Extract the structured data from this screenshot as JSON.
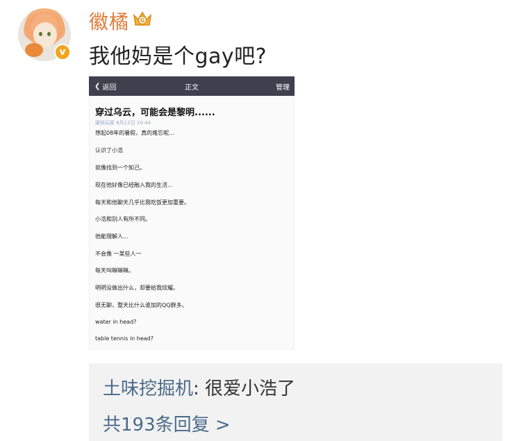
{
  "post": {
    "username": "徽橘",
    "text": "我他妈是个gay吧?",
    "vip_icon": "crown-g-icon",
    "verified_icon": "verified-v-icon"
  },
  "embedded_screenshot": {
    "nav": {
      "back_label": "返回",
      "title": "正文",
      "manage_label": "管理"
    },
    "article_title": "穿过乌云，可能会是黎明......",
    "meta": "硬核玩家 8月12日 10:44",
    "lines": [
      "想起08年的暑假，真的难忘呢...",
      "认识了小浩",
      "就像找到一个知己。",
      "现在他好像已经融入我的生活...",
      "每天和他聊天几乎比我吃饭更加重要。",
      "小浩和别人有所不同。",
      "他能理解人...",
      "不会像 一某些人一",
      "每天叫嘛嘛嘛。",
      "明明没做出什么，却要给我炫耀。",
      "很无聊，整天比什么谁加的QQ群多。",
      "water in head?",
      "table tennis in head?"
    ]
  },
  "comment": {
    "author": "土味挖掘机",
    "separator": ": ",
    "text": "很爱小浩了",
    "reply_count_label": "共193条回复 >"
  },
  "colors": {
    "username": "#e07b39",
    "link": "#4a6a8a",
    "vbadge": "#f4a31d",
    "navbar": "#3f3f4d"
  }
}
